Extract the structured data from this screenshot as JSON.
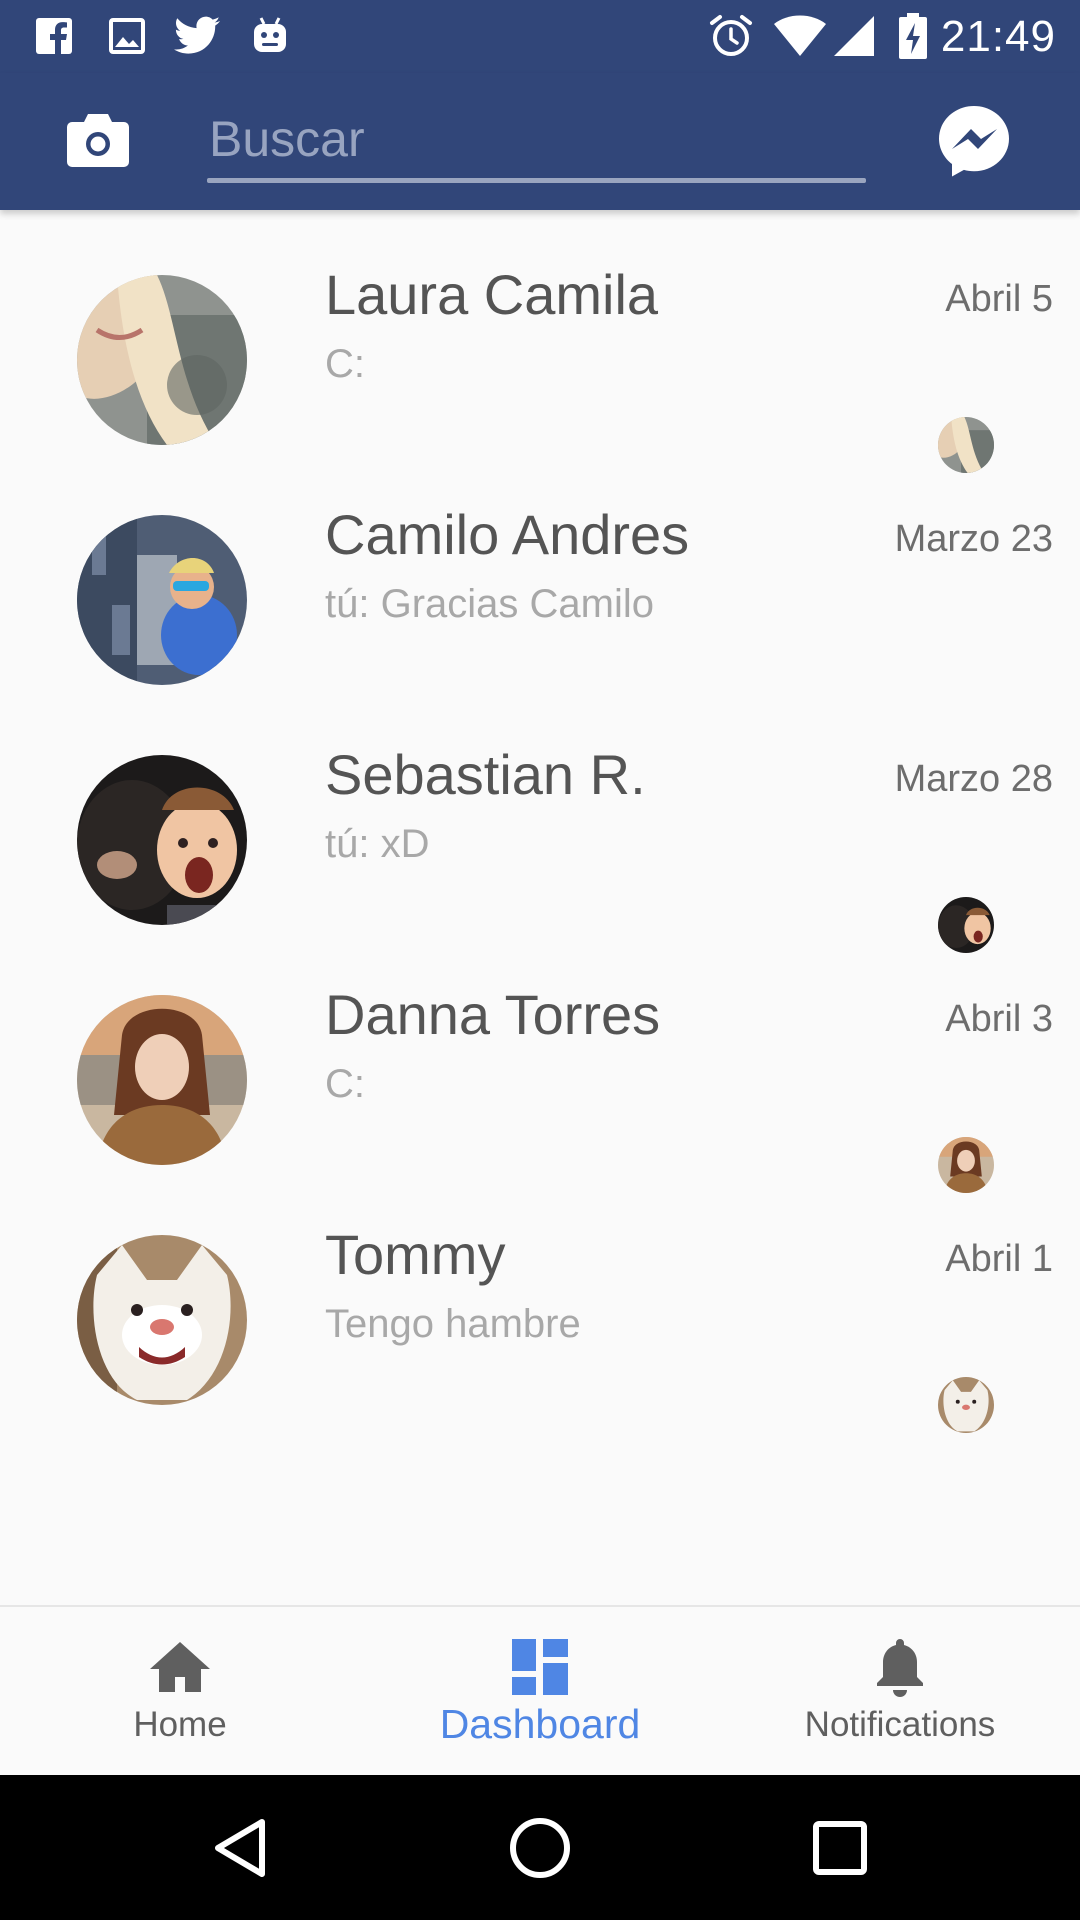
{
  "status_bar": {
    "time": "21:49",
    "left_icons": [
      "facebook-icon",
      "image-icon",
      "twitter-icon",
      "android-icon"
    ],
    "right_icons": [
      "alarm-icon",
      "wifi-icon",
      "signal-icon",
      "battery-charging-icon"
    ]
  },
  "toolbar": {
    "search_placeholder": "Buscar",
    "left_icon": "camera-icon",
    "right_icon": "messenger-icon",
    "background": "#314679"
  },
  "conversations": [
    {
      "name": "Laura Camila",
      "snippet": "C:",
      "date": "Abril 5",
      "seen": true
    },
    {
      "name": "Camilo Andres",
      "snippet": "tú: Gracias Camilo",
      "date": "Marzo 23",
      "seen": false
    },
    {
      "name": "Sebastian R.",
      "snippet": "tú: xD",
      "date": "Marzo 28",
      "seen": true
    },
    {
      "name": "Danna Torres",
      "snippet": "C:",
      "date": "Abril 3",
      "seen": true
    },
    {
      "name": "Tommy",
      "snippet": "Tengo hambre",
      "date": "Abril 1",
      "seen": true
    }
  ],
  "bottom_nav": {
    "items": [
      {
        "label": "Home",
        "icon": "home-icon",
        "active": false
      },
      {
        "label": "Dashboard",
        "icon": "dashboard-icon",
        "active": true
      },
      {
        "label": "Notifications",
        "icon": "bell-icon",
        "active": false
      }
    ],
    "active_color": "#4f86e4"
  },
  "system_nav": {
    "icons": [
      "back-icon",
      "home-circle-icon",
      "recents-icon"
    ]
  }
}
